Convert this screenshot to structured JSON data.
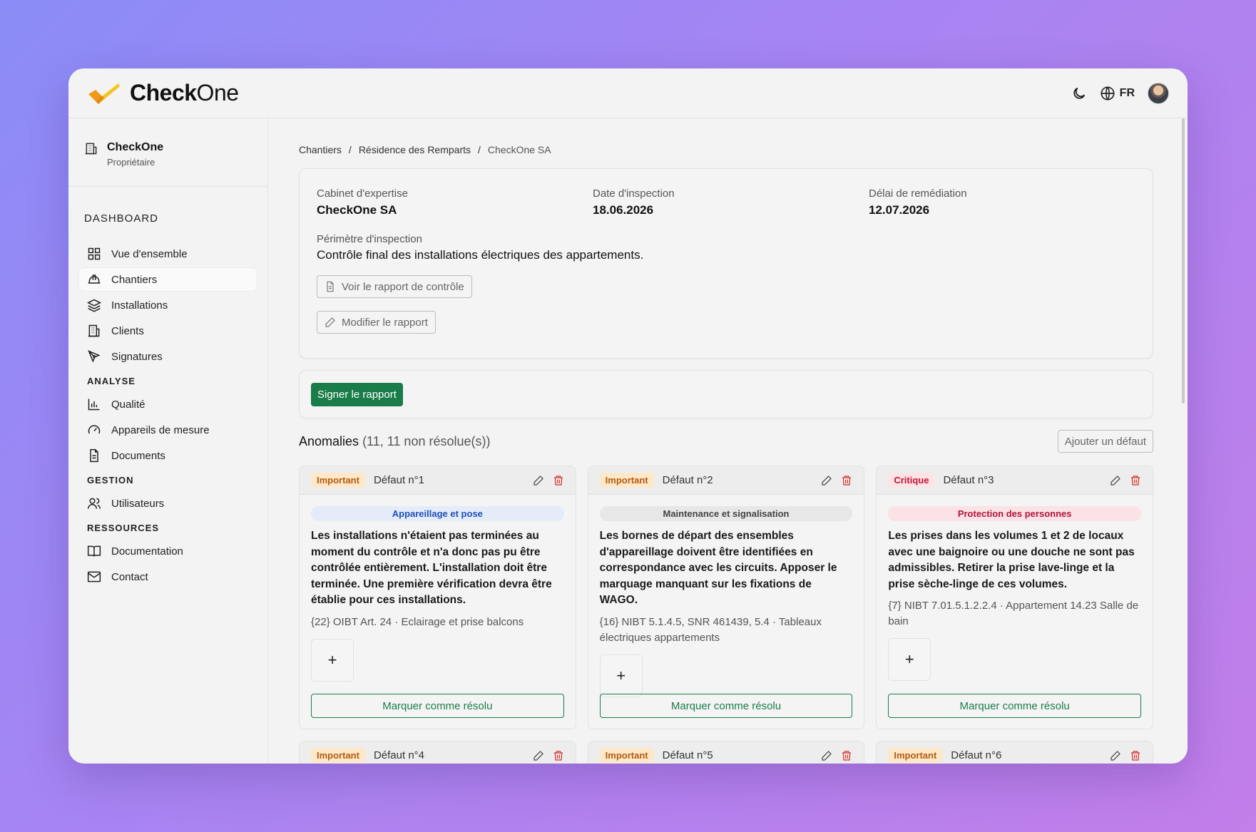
{
  "app": {
    "brand": "CheckOne",
    "brand_bold": "Check",
    "brand_light": "One",
    "lang": "FR"
  },
  "org": {
    "name": "CheckOne",
    "role": "Propriétaire"
  },
  "sidebar": {
    "sections": [
      {
        "title": "DASHBOARD",
        "items": [
          {
            "label": "Vue d'ensemble",
            "icon": "grid-icon"
          },
          {
            "label": "Chantiers",
            "icon": "hard-hat-icon",
            "active": true
          },
          {
            "label": "Installations",
            "icon": "layers-icon"
          },
          {
            "label": "Clients",
            "icon": "building-icon"
          },
          {
            "label": "Signatures",
            "icon": "pen-tool-icon"
          }
        ]
      },
      {
        "title": "ANALYSE",
        "items": [
          {
            "label": "Qualité",
            "icon": "bar-chart-icon"
          },
          {
            "label": "Appareils de mesure",
            "icon": "gauge-icon"
          },
          {
            "label": "Documents",
            "icon": "document-icon"
          }
        ]
      },
      {
        "title": "GESTION",
        "items": [
          {
            "label": "Utilisateurs",
            "icon": "users-icon"
          }
        ]
      },
      {
        "title": "RESSOURCES",
        "items": [
          {
            "label": "Documentation",
            "icon": "book-icon"
          },
          {
            "label": "Contact",
            "icon": "mail-icon"
          }
        ]
      }
    ]
  },
  "breadcrumb": [
    "Chantiers",
    "Résidence des Remparts",
    "CheckOne SA"
  ],
  "inspection": {
    "cabinet_label": "Cabinet d'expertise",
    "cabinet": "CheckOne SA",
    "date_label": "Date d'inspection",
    "date": "18.06.2026",
    "delai_label": "Délai de remédiation",
    "delai": "12.07.2026",
    "scope_label": "Périmètre d'inspection",
    "scope": "Contrôle final des installations électriques des appartements.",
    "view_report": "Voir le rapport de contrôle",
    "edit_report": "Modifier le rapport"
  },
  "sign_button": "Signer le rapport",
  "anomalies": {
    "title": "Anomalies",
    "count": "(11, 11 non résolue(s))",
    "add_button": "Ajouter un défaut",
    "resolve_label": "Marquer comme résolu",
    "items": [
      {
        "severity": "Important",
        "title": "Défaut n°1",
        "category": "Appareillage et pose",
        "description": "Les installations n'étaient pas terminées au moment du contrôle et n'a donc pas pu être contrôlée entièrement. L'installation doit être terminée. Une première vérification devra être établie pour ces installations.",
        "reference": "{22} OIBT Art. 24 · Eclairage et prise balcons"
      },
      {
        "severity": "Important",
        "title": "Défaut n°2",
        "category": "Maintenance et signalisation",
        "description": "Les bornes de départ des ensembles d'appareillage doivent être identifiées en correspondance avec les circuits. Apposer le marquage manquant sur les fixations de WAGO.",
        "reference": "{16} NIBT 5.1.4.5, SNR 461439, 5.4 · Tableaux électriques appartements"
      },
      {
        "severity": "Critique",
        "title": "Défaut n°3",
        "category": "Protection des personnes",
        "description": "Les prises dans les volumes 1 et 2 de locaux avec une baignoire ou une douche ne sont pas admissibles. Retirer la prise lave-linge et la prise sèche-linge de ces volumes.",
        "reference": "{7} NIBT 7.01.5.1.2.2.4 · Appartement 14.23 Salle de bain"
      },
      {
        "severity": "Important",
        "title": "Défaut n°4"
      },
      {
        "severity": "Important",
        "title": "Défaut n°5"
      },
      {
        "severity": "Important",
        "title": "Défaut n°6"
      }
    ]
  },
  "colors": {
    "accent_green": "#197c49",
    "important": "#b4590f",
    "critique": "#c3123a",
    "logo_orange": "#f3a21a",
    "logo_yellow": "#f5c518"
  }
}
